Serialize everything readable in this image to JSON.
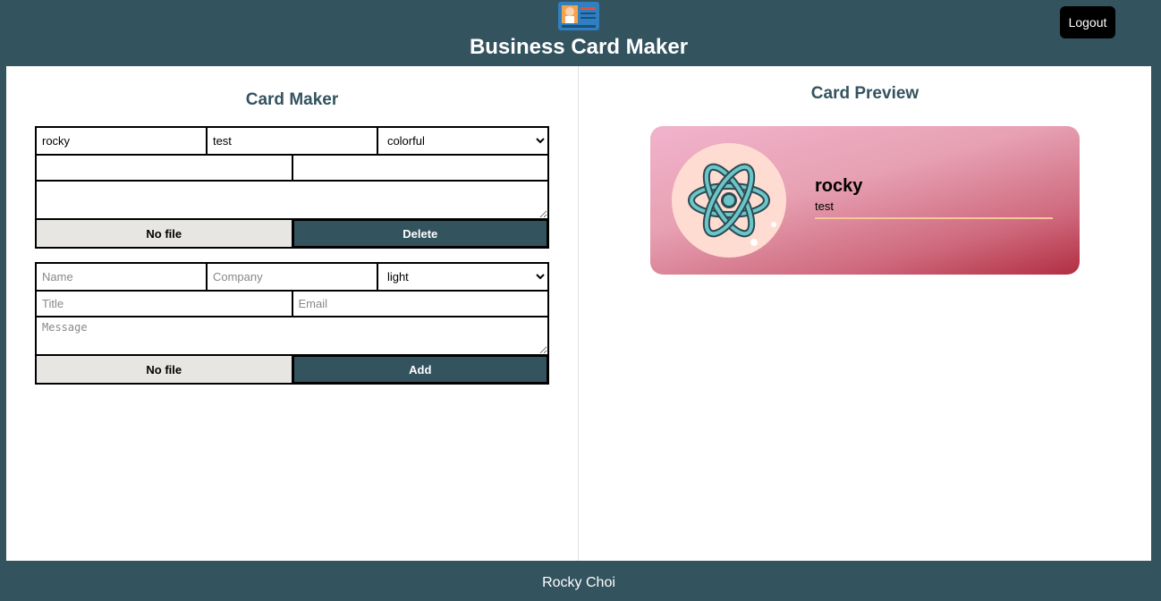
{
  "header": {
    "title": "Business Card Maker",
    "logout_label": "Logout"
  },
  "maker": {
    "title": "Card Maker",
    "cards": [
      {
        "name": "rocky",
        "company": "test",
        "theme": "colorful",
        "title": "",
        "email": "",
        "message": "",
        "file_label": "No file",
        "action_label": "Delete"
      }
    ],
    "add_form": {
      "name_placeholder": "Name",
      "company_placeholder": "Company",
      "theme": "light",
      "title_placeholder": "Title",
      "email_placeholder": "Email",
      "message_placeholder": "Message",
      "file_label": "No file",
      "action_label": "Add"
    }
  },
  "preview": {
    "title": "Card Preview",
    "card": {
      "name": "rocky",
      "company": "test",
      "theme": "colorful",
      "avatar_icon": "react-atom-icon"
    }
  },
  "footer": {
    "text": "Rocky Choi"
  },
  "colors": {
    "primary": "#33535f",
    "file_button": "#e8e6e3",
    "logout": "#000000"
  }
}
